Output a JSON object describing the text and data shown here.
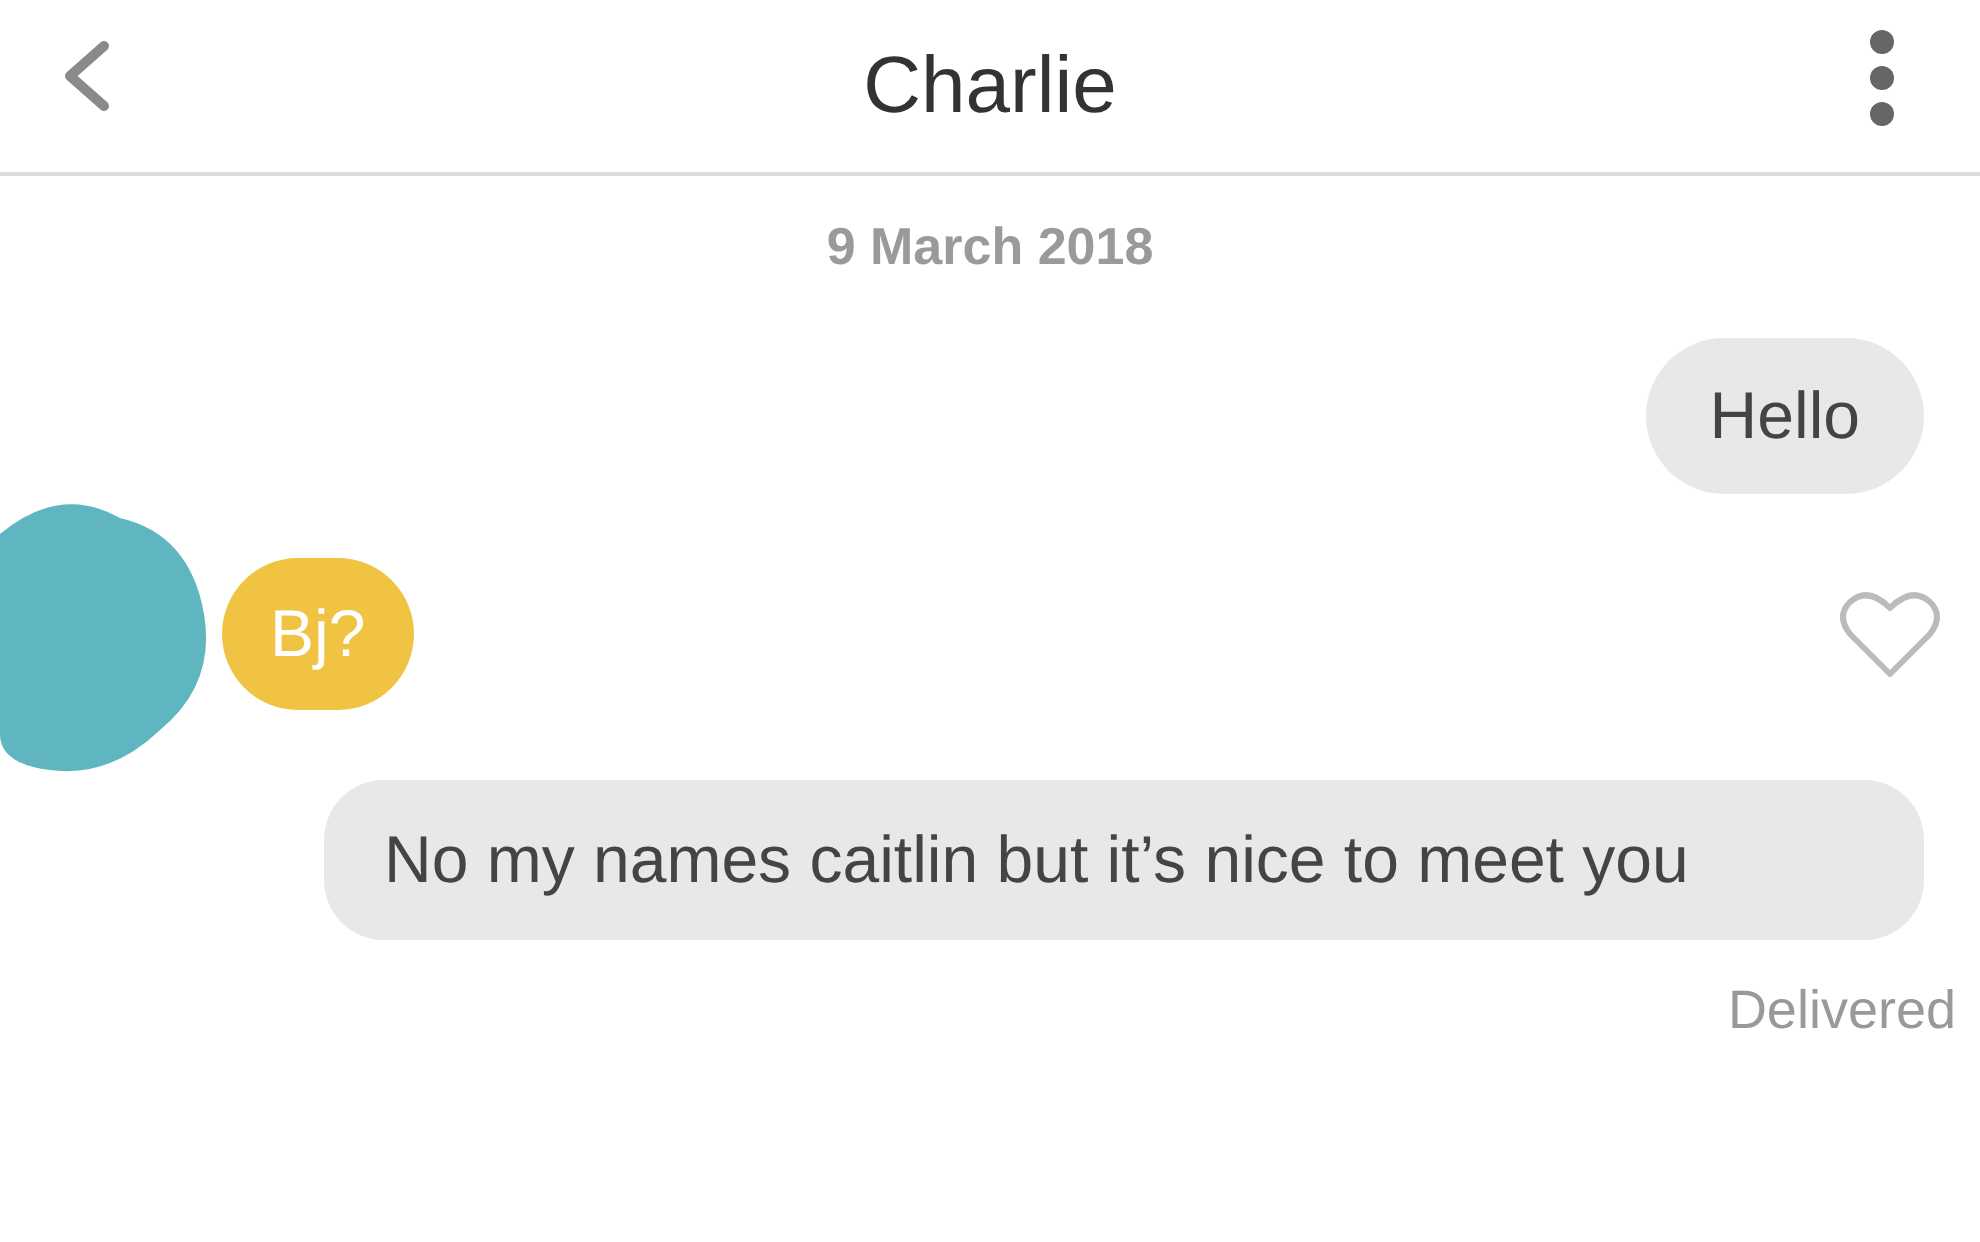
{
  "header": {
    "title": "Charlie"
  },
  "date": "9 March 2018",
  "messages": [
    {
      "kind": "sent",
      "text": "Hello"
    },
    {
      "kind": "received",
      "text": "Bj?",
      "liked": false
    },
    {
      "kind": "sent",
      "text": "No my names caitlin but it’s nice to meet you"
    }
  ],
  "status": "Delivered"
}
